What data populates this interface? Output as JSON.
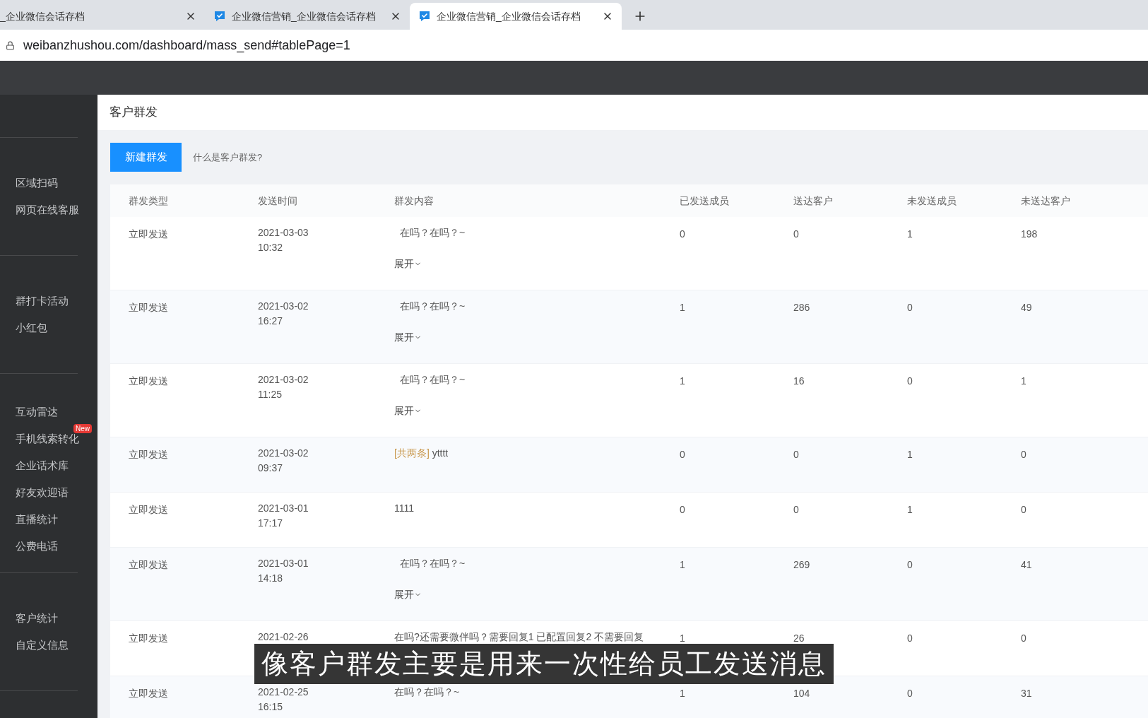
{
  "browser": {
    "tabs": [
      {
        "title": "_企业微信会话存档",
        "selected": false,
        "has_icon": false
      },
      {
        "title": "企业微信营销_企业微信会话存档",
        "selected": false,
        "has_icon": true
      },
      {
        "title": "企业微信营销_企业微信会话存档",
        "selected": true,
        "has_icon": true
      }
    ],
    "address": "weibanzhushou.com/dashboard/mass_send#tablePage=1"
  },
  "sidebar": {
    "groups": [
      [
        {
          "label": "区域扫码"
        },
        {
          "label": "网页在线客服"
        }
      ],
      [
        {
          "label": "群打卡活动"
        },
        {
          "label": "小红包"
        }
      ],
      [
        {
          "label": "互动雷达"
        },
        {
          "label": "手机线索转化",
          "badge": "New"
        },
        {
          "label": "企业话术库"
        },
        {
          "label": "好友欢迎语"
        },
        {
          "label": "直播统计"
        },
        {
          "label": "公费电话"
        }
      ],
      [
        {
          "label": "客户统计"
        },
        {
          "label": "自定义信息"
        }
      ]
    ]
  },
  "page": {
    "title": "客户群发",
    "new_button": "新建群发",
    "help_link": "什么是客户群发?"
  },
  "table": {
    "columns": [
      "群发类型",
      "发送时间",
      "群发内容",
      "已发送成员",
      "送达客户",
      "未发送成员",
      "未送达客户"
    ],
    "rows": [
      {
        "kind": "expandable",
        "type": "立即发送",
        "date": "2021-03-03",
        "time": "10:32",
        "content": "在吗？在吗？~",
        "expand": "展开",
        "sent": "0",
        "delivered": "0",
        "unsent": "1",
        "undelivered": "198"
      },
      {
        "kind": "expandable",
        "type": "立即发送",
        "date": "2021-03-02",
        "time": "16:27",
        "content": "在吗？在吗？~",
        "expand": "展开",
        "sent": "1",
        "delivered": "286",
        "unsent": "0",
        "undelivered": "49"
      },
      {
        "kind": "expandable",
        "type": "立即发送",
        "date": "2021-03-02",
        "time": "11:25",
        "content": "在吗？在吗？~",
        "expand": "展开",
        "sent": "1",
        "delivered": "16",
        "unsent": "0",
        "undelivered": "1"
      },
      {
        "kind": "plain",
        "type": "立即发送",
        "date": "2021-03-02",
        "time": "09:37",
        "tag": "[共两条]",
        "content": "ytttt",
        "sent": "0",
        "delivered": "0",
        "unsent": "1",
        "undelivered": "0"
      },
      {
        "kind": "plain",
        "type": "立即发送",
        "date": "2021-03-01",
        "time": "17:17",
        "content": "1111",
        "sent": "0",
        "delivered": "0",
        "unsent": "1",
        "undelivered": "0"
      },
      {
        "kind": "expandable",
        "type": "立即发送",
        "date": "2021-03-01",
        "time": "14:18",
        "content": "在吗？在吗？~",
        "expand": "展开",
        "sent": "1",
        "delivered": "269",
        "unsent": "0",
        "undelivered": "41"
      },
      {
        "kind": "plain",
        "type": "立即发送",
        "date": "2021-02-26",
        "content": "在吗?还需要微伴吗？需要回复1 已配置回复2 不需要回复",
        "sent": "1",
        "delivered": "26",
        "unsent": "0",
        "undelivered": "0"
      },
      {
        "kind": "plain",
        "type": "立即发送",
        "date": "2021-02-25",
        "time": "16:15",
        "content": "在吗？在吗？~",
        "sent": "1",
        "delivered": "104",
        "unsent": "0",
        "undelivered": "31"
      }
    ]
  },
  "subtitle": "像客户群发主要是用来一次性给员工发送消息"
}
